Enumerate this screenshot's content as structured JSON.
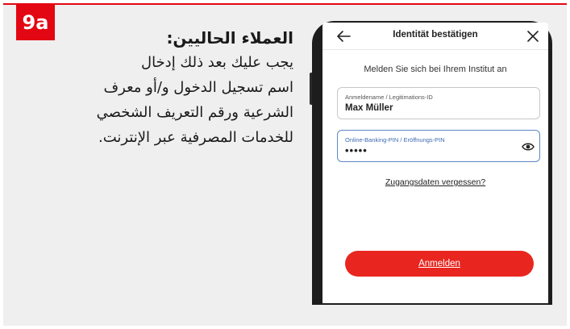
{
  "step": {
    "badge": "9a"
  },
  "instructions": {
    "heading": "العملاء الحاليين:",
    "lines": [
      "يجب عليك بعد ذلك إدخال",
      "اسم تسجيل الدخول و/أو معرف",
      "الشرعية ورقم التعريف الشخصي",
      "للخدمات المصرفية عبر الإنترنت."
    ]
  },
  "app": {
    "title": "Identität bestätigen",
    "subtitle": "Melden Sie sich bei Ihrem Institut an",
    "username_field": {
      "label": "Anmeldename / Legitimations-ID",
      "value": "Max Müller"
    },
    "pin_field": {
      "label": "Online-Banking-PIN / Eröffnungs-PIN",
      "value": "•••••"
    },
    "forgot_link": "Zugangsdaten vergessen?",
    "login_button": "Anmelden",
    "icons": {
      "back": "arrow-left-icon",
      "close": "close-icon",
      "reveal": "eye-icon"
    }
  },
  "colors": {
    "accent": "#e30613",
    "button": "#e8261f",
    "focus_border": "#5f86c6",
    "card_bg": "#efefef"
  }
}
